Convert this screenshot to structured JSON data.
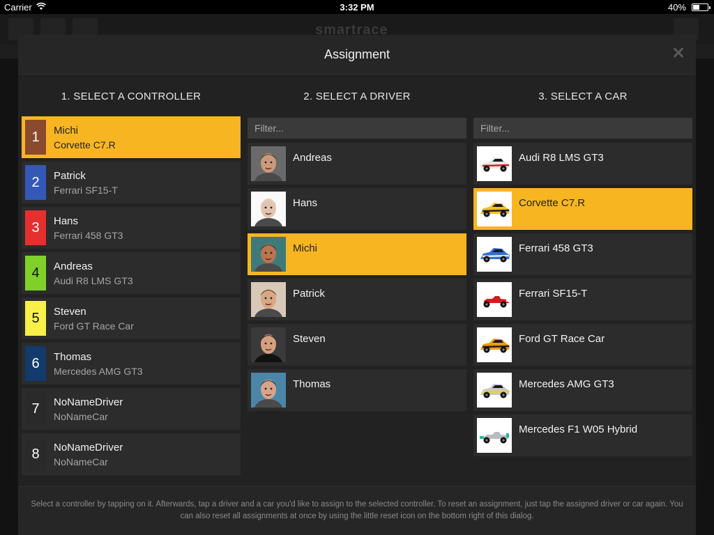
{
  "status_bar": {
    "carrier": "Carrier",
    "time": "3:32 PM",
    "battery": "40%",
    "battery_level": 0.4
  },
  "background": {
    "logo": "smartrace"
  },
  "dialog": {
    "title": "Assignment",
    "close_icon": "close-icon"
  },
  "columns": {
    "controllers": {
      "title": "1. SELECT A CONTROLLER",
      "items": [
        {
          "number": "1",
          "color": "#8a4a2e",
          "text_color": "#ffffff",
          "driver": "Michi",
          "car": "Corvette C7.R",
          "selected": true
        },
        {
          "number": "2",
          "color": "#3358b8",
          "text_color": "#ffffff",
          "driver": "Patrick",
          "car": "Ferrari SF15-T",
          "selected": false
        },
        {
          "number": "3",
          "color": "#e5302f",
          "text_color": "#ffffff",
          "driver": "Hans",
          "car": "Ferrari 458 GT3",
          "selected": false
        },
        {
          "number": "4",
          "color": "#7fd12a",
          "text_color": "#111111",
          "driver": "Andreas",
          "car": "Audi R8 LMS GT3",
          "selected": false
        },
        {
          "number": "5",
          "color": "#f6f047",
          "text_color": "#111111",
          "driver": "Steven",
          "car": "Ford GT Race Car",
          "selected": false
        },
        {
          "number": "6",
          "color": "#123a6a",
          "text_color": "#ffffff",
          "driver": "Thomas",
          "car": "Mercedes AMG GT3",
          "selected": false
        },
        {
          "number": "7",
          "color": "#2a2a2a",
          "text_color": "#ffffff",
          "driver": "NoNameDriver",
          "car": "NoNameCar",
          "selected": false
        },
        {
          "number": "8",
          "color": "#2a2a2a",
          "text_color": "#ffffff",
          "driver": "NoNameDriver",
          "car": "NoNameCar",
          "selected": false
        }
      ]
    },
    "drivers": {
      "title": "2. SELECT A DRIVER",
      "filter_placeholder": "Filter...",
      "items": [
        {
          "name": "Andreas",
          "selected": false
        },
        {
          "name": "Hans",
          "selected": false
        },
        {
          "name": "Michi",
          "selected": true
        },
        {
          "name": "Patrick",
          "selected": false
        },
        {
          "name": "Steven",
          "selected": false
        },
        {
          "name": "Thomas",
          "selected": false
        }
      ]
    },
    "cars": {
      "title": "3. SELECT A CAR",
      "filter_placeholder": "Filter...",
      "items": [
        {
          "name": "Audi R8 LMS GT3",
          "body_color": "#e8e8e8",
          "accent": "#d62020",
          "selected": false
        },
        {
          "name": "Corvette C7.R",
          "body_color": "#f5c21b",
          "accent": "#222222",
          "selected": true
        },
        {
          "name": "Ferrari 458 GT3",
          "body_color": "#2f6fd6",
          "accent": "#e8e8e8",
          "selected": false
        },
        {
          "name": "Ferrari SF15-T",
          "body_color": "#d41c1c",
          "accent": "#ffffff",
          "selected": false
        },
        {
          "name": "Ford GT Race Car",
          "body_color": "#f09a1a",
          "accent": "#222222",
          "selected": false
        },
        {
          "name": "Mercedes AMG GT3",
          "body_color": "#c9c9c9",
          "accent": "#f1d21b",
          "selected": false
        },
        {
          "name": "Mercedes F1 W05 Hybrid",
          "body_color": "#b8bcc0",
          "accent": "#22b8a6",
          "selected": false
        }
      ]
    }
  },
  "help_text": "Select a controller by tapping on it. Afterwards, tap a driver and a car you'd like to assign to the selected controller. To reset an assignment, just tap the assigned driver or car again. You can also reset all assignments at once by using the little reset icon on the bottom right of this dialog."
}
